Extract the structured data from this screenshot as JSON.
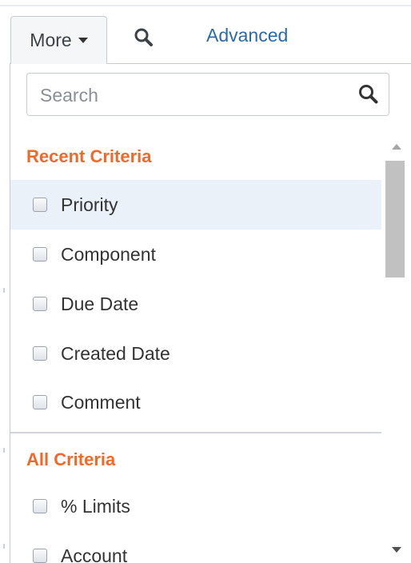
{
  "toolbar": {
    "more_label": "More",
    "search_icon": "search-icon",
    "advanced_label": "Advanced"
  },
  "dropdown": {
    "search": {
      "placeholder": "Search",
      "icon": "search-icon"
    },
    "recent_heading": "Recent Criteria",
    "recent_items": [
      {
        "label": "Priority",
        "checked": false,
        "highlighted": true
      },
      {
        "label": "Component",
        "checked": false
      },
      {
        "label": "Due Date",
        "checked": false
      },
      {
        "label": "Created Date",
        "checked": false
      },
      {
        "label": "Comment",
        "checked": false
      }
    ],
    "all_heading": "All Criteria",
    "all_items": [
      {
        "label": "% Limits",
        "checked": false
      },
      {
        "label": "Account",
        "checked": false
      }
    ]
  },
  "colors": {
    "heading": "#f0692a",
    "link": "#2c6aa6",
    "highlight": "#ebf1f8"
  }
}
